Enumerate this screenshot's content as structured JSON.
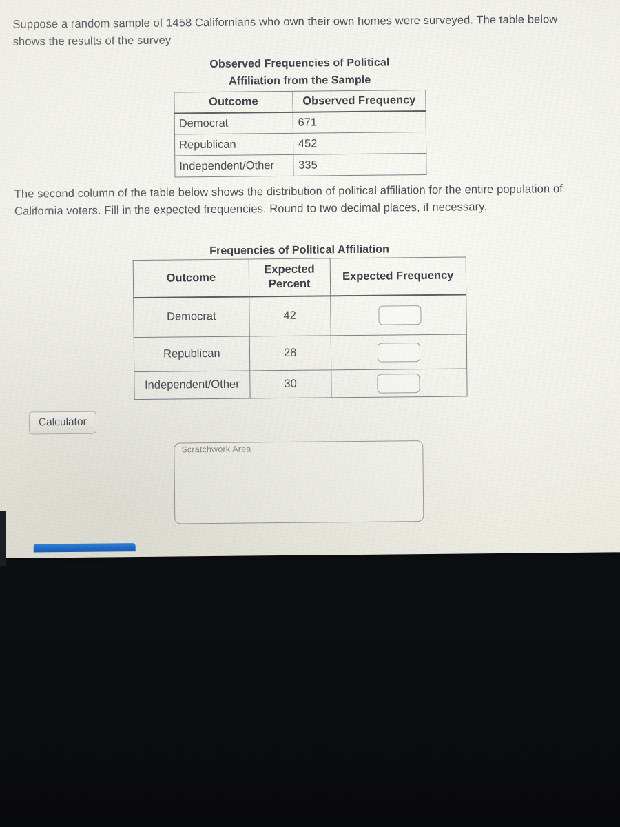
{
  "question": {
    "intro": "Suppose a random sample of 1458 Californians who own their own homes were surveyed. The table below shows the results of the survey",
    "instructions": "The second column of the table below shows the distribution of political affiliation for the entire population of California voters.  Fill in the expected frequencies. Round to two decimal places, if necessary."
  },
  "observed_table": {
    "title_line1": "Observed Frequencies of Political",
    "title_line2": "Affiliation from the Sample",
    "headers": [
      "Outcome",
      "Observed Frequency"
    ],
    "rows": [
      {
        "outcome": "Democrat",
        "frequency": "671"
      },
      {
        "outcome": "Republican",
        "frequency": "452"
      },
      {
        "outcome": "Independent/Other",
        "frequency": "335"
      }
    ]
  },
  "expected_table": {
    "title": "Frequencies of Political Affiliation",
    "headers": [
      "Outcome",
      "Expected Percent",
      "Expected Frequency"
    ],
    "header_percent_line1": "Expected",
    "header_percent_line2": "Percent",
    "rows": [
      {
        "outcome": "Democrat",
        "percent": "42",
        "frequency": ""
      },
      {
        "outcome": "Republican",
        "percent": "28",
        "frequency": ""
      },
      {
        "outcome": "Independent/Other",
        "percent": "30",
        "frequency": ""
      }
    ]
  },
  "controls": {
    "calculator_label": "Calculator",
    "scratchwork_label": "Scratchwork Area",
    "scratchwork_value": ""
  },
  "colors": {
    "screen_background": "#f4f3ec",
    "body_text": "#4c4f56",
    "heading_text": "#3e434c",
    "table_border": "#7d808a",
    "input_border": "#9aa0ab",
    "accent_blue": "#1f6fd0",
    "desk_dark": "#14171b"
  }
}
